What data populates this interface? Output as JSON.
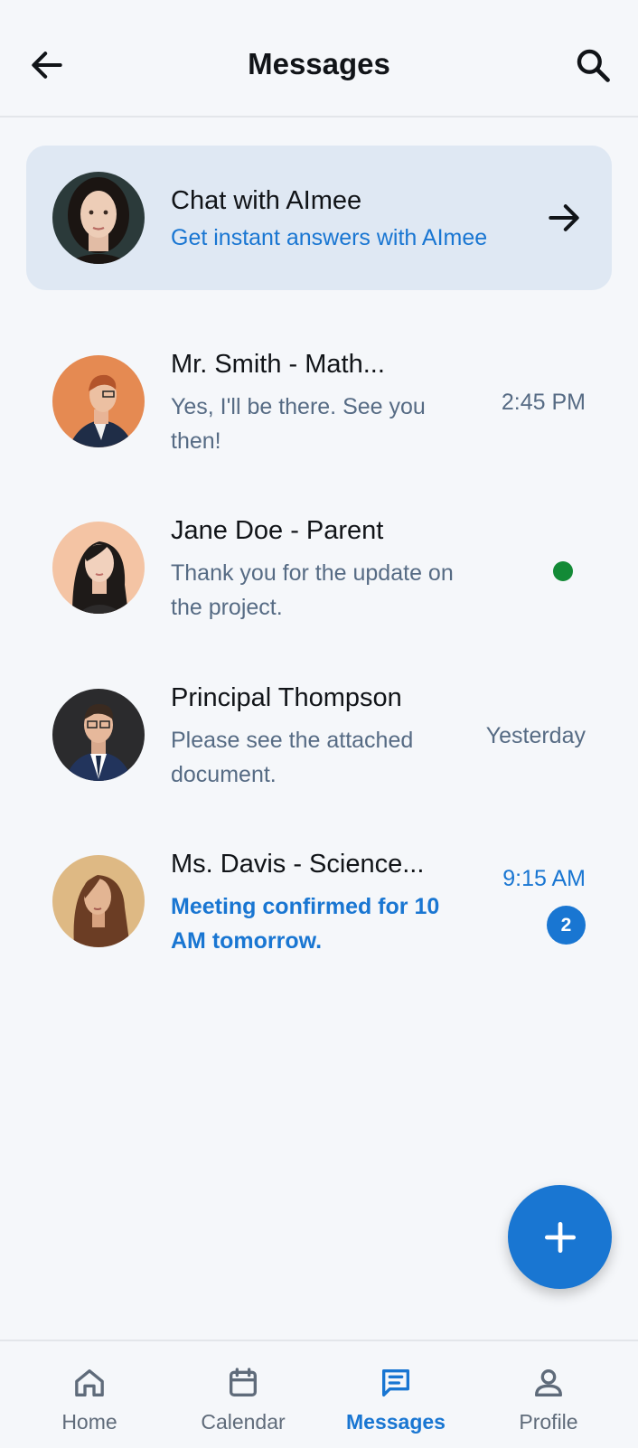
{
  "header": {
    "title": "Messages",
    "back_icon": "arrow-left-icon",
    "search_icon": "search-icon"
  },
  "ai_chat": {
    "title": "Chat with AImee",
    "subtitle": "Get instant answers with AImee",
    "arrow_icon": "arrow-right-icon"
  },
  "conversations": [
    {
      "name": "Mr. Smith - Math...",
      "preview": "Yes, I'll be there. See you then!",
      "time": "2:45 PM"
    },
    {
      "name": "Jane Doe - Parent",
      "preview": "Thank you for the update on the project.",
      "status": "online"
    },
    {
      "name": "Principal Thompson",
      "preview": "Please see the attached document.",
      "time": "Yesterday"
    },
    {
      "name": "Ms. Davis - Science...",
      "preview": "Meeting confirmed for 10 AM tomorrow.",
      "time": "9:15 AM",
      "unread_count": "2"
    }
  ],
  "fab": {
    "icon": "plus-icon"
  },
  "bottom_nav": {
    "items": [
      {
        "label": "Home",
        "icon": "home-icon"
      },
      {
        "label": "Calendar",
        "icon": "calendar-icon"
      },
      {
        "label": "Messages",
        "icon": "chat-icon",
        "active": true
      },
      {
        "label": "Profile",
        "icon": "person-icon"
      }
    ]
  },
  "colors": {
    "accent": "#1976d2",
    "online": "#138a36",
    "card": "#dfe8f3",
    "background": "#f5f7fa"
  }
}
